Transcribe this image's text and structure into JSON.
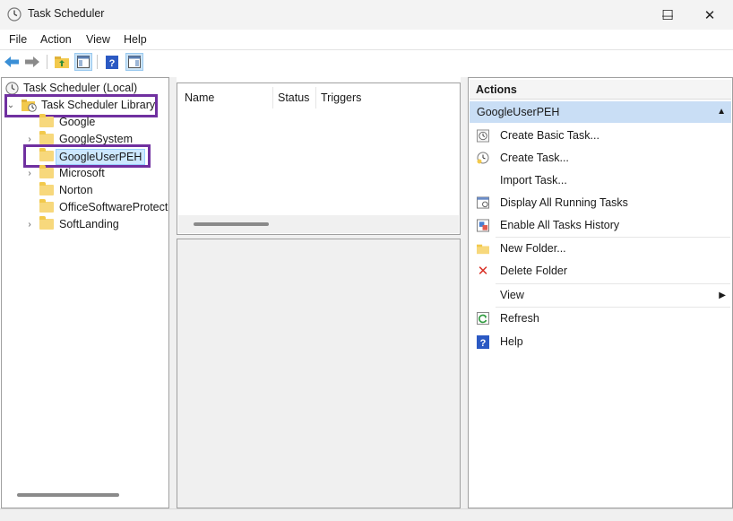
{
  "window": {
    "title": "Task Scheduler",
    "controls": {
      "minimize": "—",
      "maximize": "☐",
      "close": "✕"
    }
  },
  "menu": [
    "File",
    "Action",
    "View",
    "Help"
  ],
  "toolbar": {
    "buttons": [
      "back-icon",
      "forward-icon",
      "up-folder-icon",
      "show-hide-console-tree-icon",
      "help-icon",
      "show-hide-action-pane-icon"
    ]
  },
  "tree": {
    "root": "Task Scheduler (Local)",
    "library": "Task Scheduler Library",
    "items": [
      {
        "label": "Google",
        "expandable": false
      },
      {
        "label": "GoogleSystem",
        "expandable": true
      },
      {
        "label": "GoogleUserPEH",
        "expandable": false,
        "selected": true
      },
      {
        "label": "Microsoft",
        "expandable": true
      },
      {
        "label": "Norton",
        "expandable": false
      },
      {
        "label": "OfficeSoftwareProtecti",
        "expandable": false
      },
      {
        "label": "SoftLanding",
        "expandable": true
      }
    ]
  },
  "task_list": {
    "columns": [
      "Name",
      "Status",
      "Triggers"
    ]
  },
  "actions": {
    "header": "Actions",
    "group": "GoogleUserPEH",
    "items": [
      {
        "label": "Create Basic Task...",
        "icon": "create-basic-task-icon"
      },
      {
        "label": "Create Task...",
        "icon": "create-task-icon"
      },
      {
        "label": "Import Task...",
        "icon": ""
      },
      {
        "label": "Display All Running Tasks",
        "icon": "running-tasks-icon"
      },
      {
        "label": "Enable All Tasks History",
        "icon": "tasks-history-icon"
      },
      {
        "label": "New Folder...",
        "icon": "new-folder-icon"
      },
      {
        "label": "Delete Folder",
        "icon": "delete-icon"
      },
      {
        "label": "View",
        "icon": ""
      },
      {
        "label": "Refresh",
        "icon": "refresh-icon"
      },
      {
        "label": "Help",
        "icon": "help-icon"
      }
    ]
  },
  "colors": {
    "highlight_box": "#7030a0",
    "group_header": "#c9def5",
    "selection": "#cce8ff"
  }
}
